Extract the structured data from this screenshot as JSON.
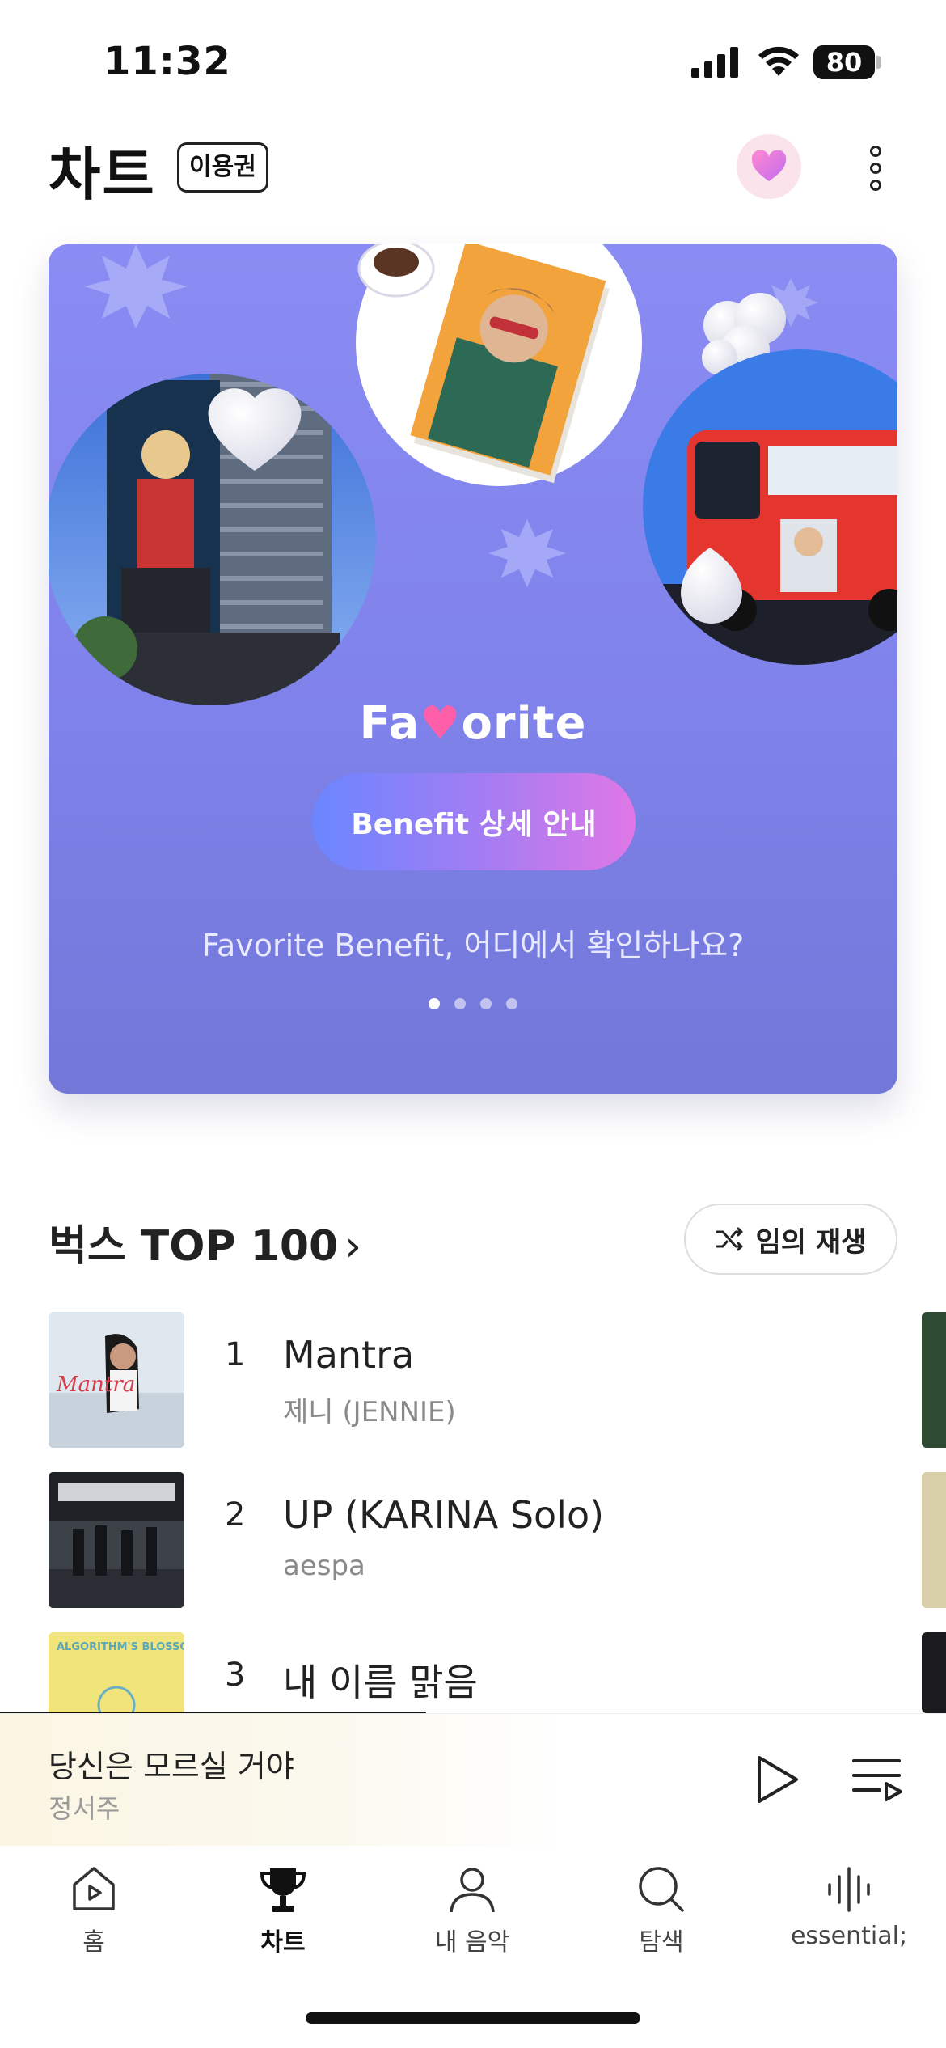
{
  "status_bar": {
    "time": "11:32",
    "battery": "80"
  },
  "header": {
    "title": "차트",
    "pass_badge": "이용권"
  },
  "banner": {
    "brand_prefix": "Fa",
    "brand_suffix": "orite",
    "button_label": "Benefit 상세 안내",
    "caption": "Favorite Benefit, 어디에서 확인하나요?",
    "slide_count": 4,
    "active_slide": 1
  },
  "section": {
    "title": "벅스 TOP 100",
    "shuffle_label": "임의 재생"
  },
  "chart": [
    {
      "rank": "1",
      "title": "Mantra",
      "artist": "제니 (JENNIE)"
    },
    {
      "rank": "2",
      "title": "UP (KARINA Solo)",
      "artist": "aespa"
    },
    {
      "rank": "3",
      "title": "내 이름 맑음",
      "artist": ""
    }
  ],
  "mini_player": {
    "title": "당신은 모르실 거야",
    "artist": "정서주",
    "progress": 0.45
  },
  "tabs": [
    {
      "label": "홈",
      "icon": "home-play-icon"
    },
    {
      "label": "차트",
      "icon": "trophy-icon",
      "active": true
    },
    {
      "label": "내 음악",
      "icon": "person-icon"
    },
    {
      "label": "탐색",
      "icon": "search-icon"
    },
    {
      "label": "essential;",
      "icon": "waveform-icon"
    }
  ],
  "colors": {
    "banner_bg": "#8a8cf3",
    "button_gradient_start": "#6a86ff",
    "button_gradient_end": "#e078e6",
    "heart_pink": "#ff5fa8"
  }
}
